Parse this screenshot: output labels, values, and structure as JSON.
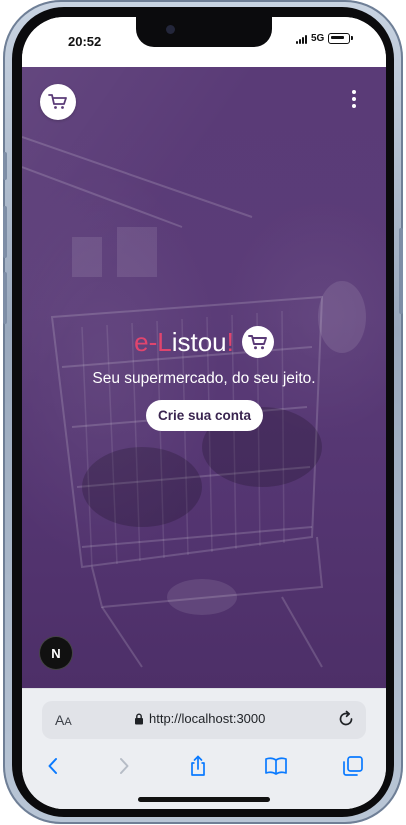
{
  "status_bar": {
    "time": "20:52",
    "network": "5G"
  },
  "hero": {
    "brand": {
      "prefix": "e-",
      "initial": "L",
      "rest": "istou",
      "exclaim": "!"
    },
    "tagline": "Seu supermercado, do seu jeito.",
    "cta_label": "Crie sua conta",
    "dev_badge": "N"
  },
  "browser": {
    "text_size_label": "A",
    "text_size_label_small": "A",
    "url": "http://localhost:3000"
  },
  "icons": {
    "cart": "cart-icon",
    "menu": "more-vertical-icon",
    "lock": "lock-icon",
    "reload": "reload-icon",
    "back": "chevron-left-icon",
    "forward": "chevron-right-icon",
    "share": "share-icon",
    "bookmarks": "book-icon",
    "tabs": "tabs-icon"
  },
  "colors": {
    "hero_purple": "#5a3b77",
    "brand_pink": "#e0456e",
    "ios_blue": "#0a7aff"
  }
}
